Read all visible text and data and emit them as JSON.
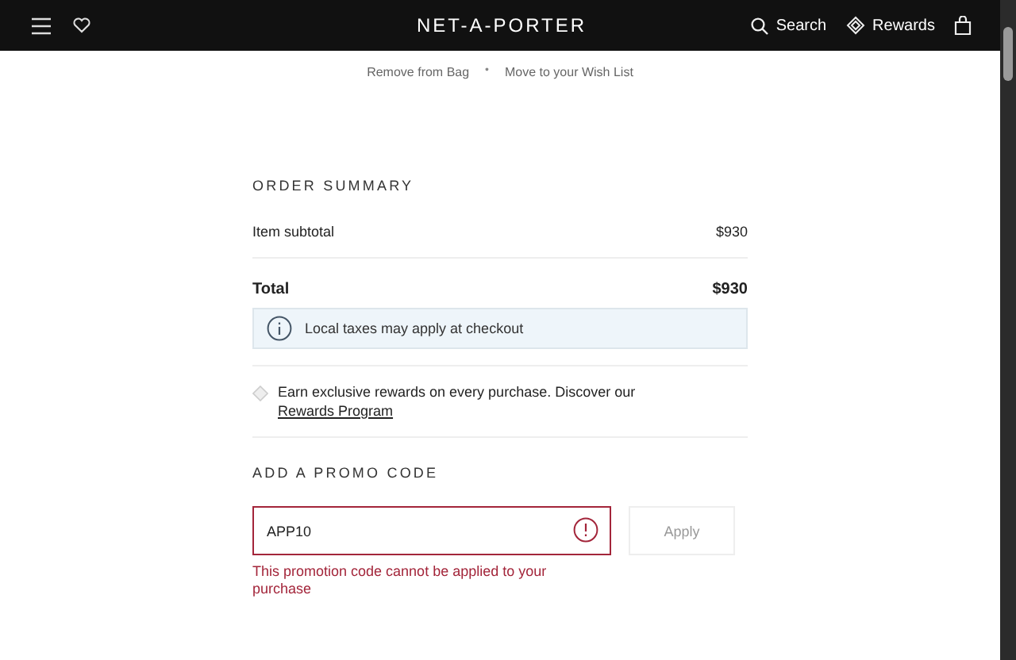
{
  "header": {
    "logo": "NET-A-PORTER",
    "search": "Search",
    "rewards": "Rewards"
  },
  "bag_actions": [
    "Remove from Bag",
    "Move to your Wish List"
  ],
  "separator": "•",
  "order_summary": {
    "title": "ORDER SUMMARY",
    "rows": [
      {
        "label": "Item subtotal",
        "value": "$930",
        "kind": "normal"
      },
      {
        "label": "Total",
        "value": "$930",
        "kind": "total"
      }
    ],
    "notice": "Local taxes may apply at checkout",
    "rewards_text": "Earn exclusive rewards on every purchase. Discover our ",
    "rewards_link": "Rewards Program"
  },
  "promo": {
    "title": "ADD A PROMO CODE",
    "value": "APP10",
    "error": "This promotion code cannot be applied to your purchase",
    "has_error": true,
    "button": "Apply",
    "button_disabled": true
  }
}
